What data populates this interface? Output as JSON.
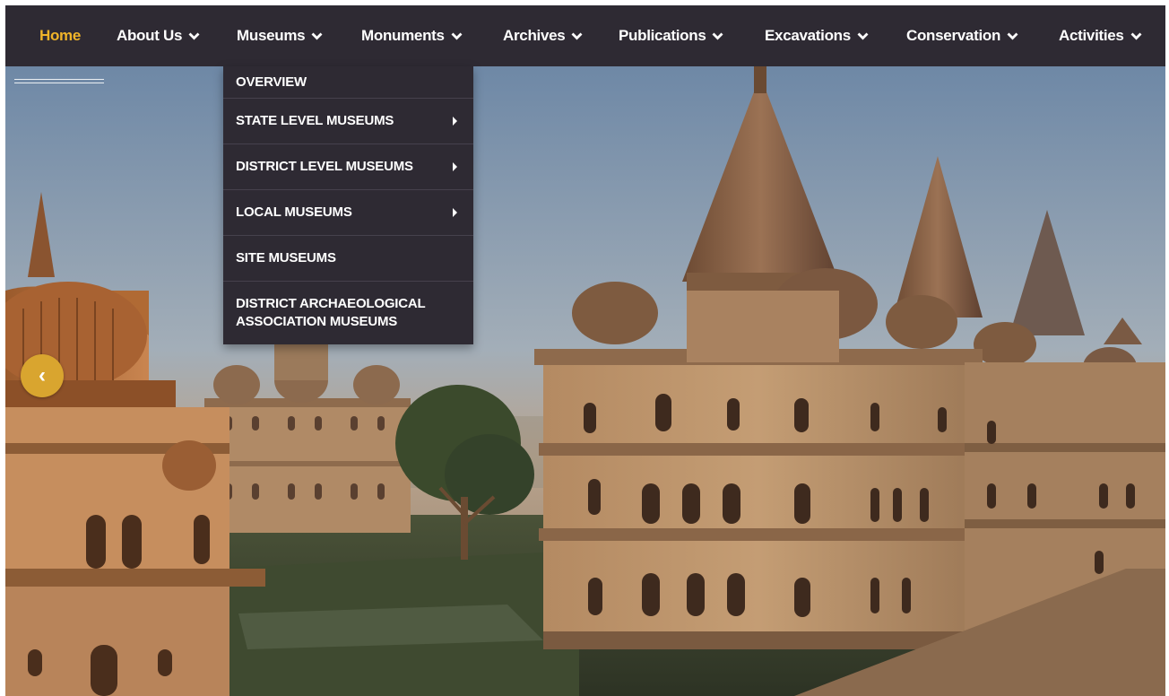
{
  "nav": {
    "items": [
      {
        "label": "Home",
        "active": true,
        "has_dropdown": false
      },
      {
        "label": "About Us",
        "has_dropdown": true
      },
      {
        "label": "Museums",
        "has_dropdown": true
      },
      {
        "label": "Monuments",
        "has_dropdown": true
      },
      {
        "label": "Archives",
        "has_dropdown": true
      },
      {
        "label": "Publications",
        "has_dropdown": true
      },
      {
        "label": "Excavations",
        "has_dropdown": true
      },
      {
        "label": "Conservation",
        "has_dropdown": true
      },
      {
        "label": "Activities",
        "has_dropdown": true
      }
    ]
  },
  "dropdown": {
    "items": [
      {
        "label": "OVERVIEW",
        "has_submenu": false
      },
      {
        "label": "STATE LEVEL MUSEUMS",
        "has_submenu": true
      },
      {
        "label": "DISTRICT LEVEL MUSEUMS",
        "has_submenu": true
      },
      {
        "label": "LOCAL MUSEUMS",
        "has_submenu": true
      },
      {
        "label": "SITE MUSEUMS",
        "has_submenu": false
      },
      {
        "label": "DISTRICT ARCHAEOLOGICAL ASSOCIATION MUSEUMS",
        "has_submenu": false
      }
    ]
  },
  "hero": {
    "prev_icon": "‹"
  },
  "colors": {
    "navbar_bg": "#2e2a33",
    "active_link": "#f0b429",
    "accent_button": "#d9a52f"
  }
}
